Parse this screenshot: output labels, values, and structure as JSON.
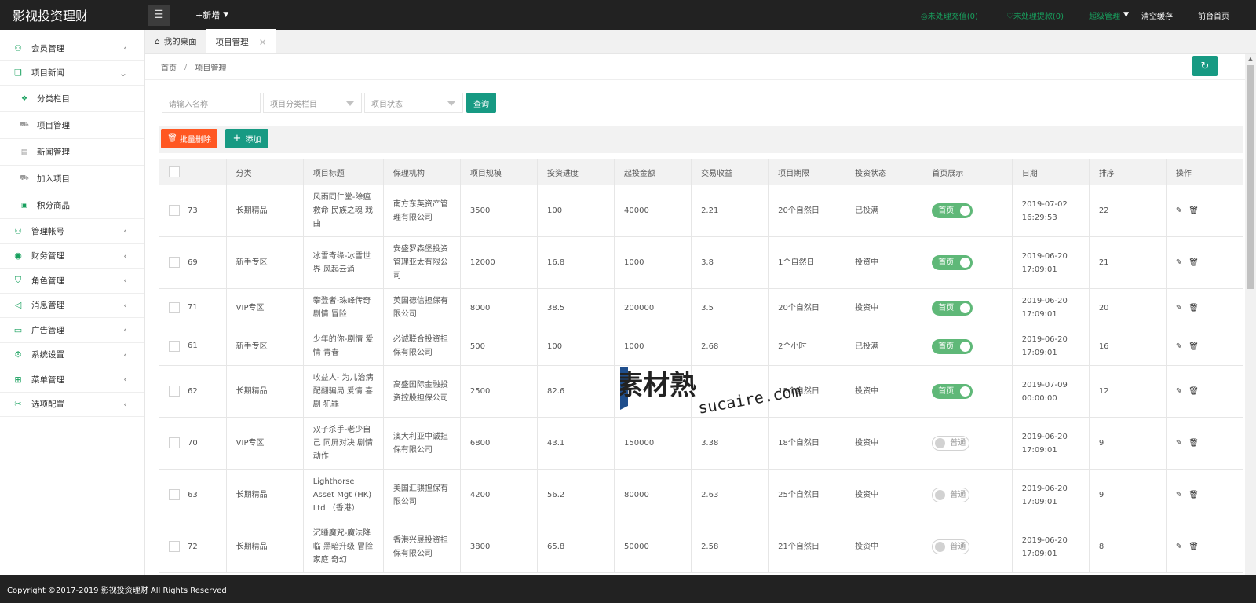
{
  "header": {
    "logo": "影视投资理财",
    "new_label": "+新增",
    "pending_recharge": "◎未处理充值(0)",
    "pending_withdraw": "♡未处理提款(0)",
    "admin_label": "超级管理",
    "clear_cache": "清空缓存",
    "home_label": "前台首页"
  },
  "sidebar": {
    "items": [
      {
        "label": "会员管理",
        "icon": "user-icon"
      },
      {
        "label": "项目新闻",
        "icon": "book-icon"
      },
      {
        "label": "管理帐号",
        "icon": "users-icon"
      },
      {
        "label": "财务管理",
        "icon": "money-icon"
      },
      {
        "label": "角色管理",
        "icon": "shield-icon"
      },
      {
        "label": "消息管理",
        "icon": "speaker-icon"
      },
      {
        "label": "广告管理",
        "icon": "image-icon"
      },
      {
        "label": "系统设置",
        "icon": "gear-icon"
      },
      {
        "label": "菜单管理",
        "icon": "grid-icon"
      },
      {
        "label": "选项配置",
        "icon": "tools-icon"
      }
    ],
    "subitems": [
      {
        "label": "分类栏目"
      },
      {
        "label": "项目管理"
      },
      {
        "label": "新闻管理"
      },
      {
        "label": "加入项目"
      },
      {
        "label": "积分商品"
      }
    ]
  },
  "tabs": [
    {
      "label": "我的桌面"
    },
    {
      "label": "项目管理"
    }
  ],
  "breadcrumb": {
    "home": "首页",
    "sep": "/",
    "current": "项目管理"
  },
  "filters": {
    "name_placeholder": "请输入名称",
    "category_placeholder": "项目分类栏目",
    "status_placeholder": "项目状态",
    "query_label": "查询"
  },
  "toolbar": {
    "batch_delete": "批量删除",
    "add": "添加"
  },
  "table": {
    "headers": [
      "",
      "分类",
      "项目标题",
      "保理机构",
      "项目规模",
      "投资进度",
      "起投金额",
      "交易收益",
      "项目期限",
      "投资状态",
      "首页展示",
      "日期",
      "排序",
      "操作"
    ],
    "rows": [
      {
        "id": "73",
        "category": "长期精品",
        "title": "风雨同仁堂-除瘟救命 民族之魂 戏曲",
        "org": "南方东英资产管理有限公司",
        "scale": "3500",
        "progress": "100",
        "min": "40000",
        "yield": "2.21",
        "term": "20个自然日",
        "status": "已投满",
        "home": "首页",
        "home_on": true,
        "date": "2019-07-02 16:29:53",
        "sort": "22"
      },
      {
        "id": "69",
        "category": "新手专区",
        "title": "冰雪奇缘-冰雪世界 风起云涌",
        "org": "安盛罗森堡投资管理亚太有限公司",
        "scale": "12000",
        "progress": "16.8",
        "min": "1000",
        "yield": "3.8",
        "term": "1个自然日",
        "status": "投资中",
        "home": "首页",
        "home_on": true,
        "date": "2019-06-20 17:09:01",
        "sort": "21"
      },
      {
        "id": "71",
        "category": "VIP专区",
        "title": "攀登者-珠峰传奇 剧情 冒险",
        "org": "英国德信担保有限公司",
        "scale": "8000",
        "progress": "38.5",
        "min": "200000",
        "yield": "3.5",
        "term": "20个自然日",
        "status": "投资中",
        "home": "首页",
        "home_on": true,
        "date": "2019-06-20 17:09:01",
        "sort": "20"
      },
      {
        "id": "61",
        "category": "新手专区",
        "title": "少年的你-剧情 爱情 青春",
        "org": "必诚联合投资担保有限公司",
        "scale": "500",
        "progress": "100",
        "min": "1000",
        "yield": "2.68",
        "term": "2个小时",
        "status": "已投满",
        "home": "首页",
        "home_on": true,
        "date": "2019-06-20 17:09:01",
        "sort": "16"
      },
      {
        "id": "62",
        "category": "长期精品",
        "title": "收益人- 为儿治病 配翻骗局 爱情 喜剧 犯罪",
        "org": "高盛国际金融投资控股担保公司",
        "scale": "2500",
        "progress": "82.6",
        "min": "",
        "yield": "",
        "term": "15个自然日",
        "status": "投资中",
        "home": "首页",
        "home_on": true,
        "date": "2019-07-09 00:00:00",
        "sort": "12"
      },
      {
        "id": "70",
        "category": "VIP专区",
        "title": "双子杀手-老少自己 同屏对决 剧情 动作",
        "org": "澳大利亚中诚担保有限公司",
        "scale": "6800",
        "progress": "43.1",
        "min": "150000",
        "yield": "3.38",
        "term": "18个自然日",
        "status": "投资中",
        "home": "普通",
        "home_on": false,
        "date": "2019-06-20 17:09:01",
        "sort": "9"
      },
      {
        "id": "63",
        "category": "长期精品",
        "title": "Lighthorse Asset Mgt (HK) Ltd （香港）",
        "org": "美国汇骐担保有限公司",
        "scale": "4200",
        "progress": "56.2",
        "min": "80000",
        "yield": "2.63",
        "term": "25个自然日",
        "status": "投资中",
        "home": "普通",
        "home_on": false,
        "date": "2019-06-20 17:09:01",
        "sort": "9"
      },
      {
        "id": "72",
        "category": "长期精品",
        "title": "沉睡魔咒-魔法降临 黑暗升级 冒险 家庭 奇幻",
        "org": "香港兴晟投资担保有限公司",
        "scale": "3800",
        "progress": "65.8",
        "min": "50000",
        "yield": "2.58",
        "term": "21个自然日",
        "status": "投资中",
        "home": "普通",
        "home_on": false,
        "date": "2019-06-20 17:09:01",
        "sort": "8"
      }
    ]
  },
  "watermark": {
    "cn": "素材熟",
    "en": "sucaire.com"
  },
  "footer": {
    "copyright": "Copyright ©2017-2019 影视投资理财 All Rights Reserved"
  },
  "colors": {
    "accent": "#179a83",
    "danger": "#ff5722",
    "switch_on": "#5fb878",
    "header_bg": "#222222"
  }
}
